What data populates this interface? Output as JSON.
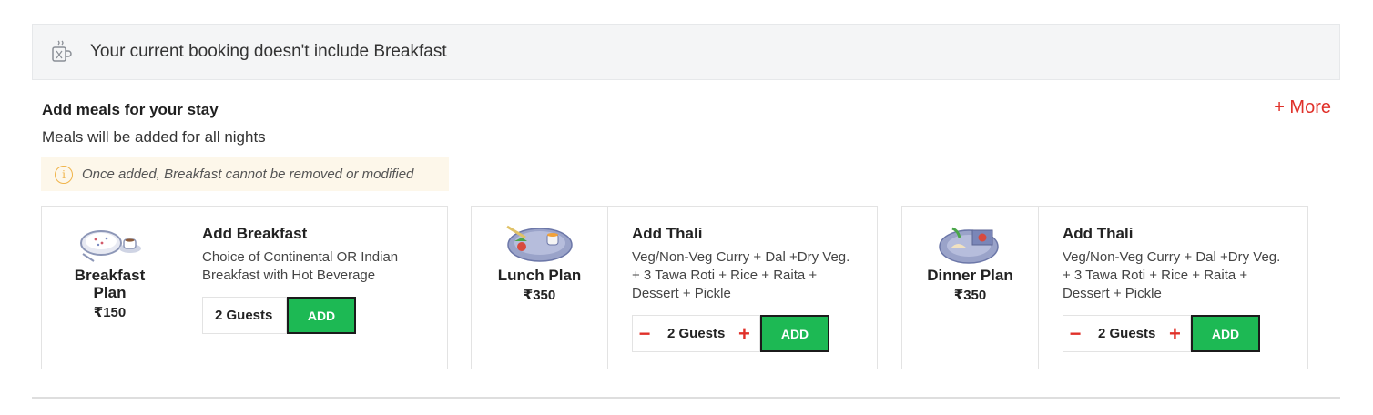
{
  "banner": {
    "text": "Your current booking doesn't include Breakfast",
    "icon": "coffee-cup-icon"
  },
  "section": {
    "title": "Add meals for your stay",
    "subtitle": "Meals will be added for all nights",
    "more_label": "+ More"
  },
  "notice": {
    "text": "Once added, Breakfast cannot be removed or modified",
    "icon": "info-icon"
  },
  "cards": [
    {
      "plan_name": "Breakfast Plan",
      "price": "₹150",
      "title": "Add Breakfast",
      "description": "Choice of Continental OR Indian Breakfast with Hot Beverage",
      "guests": "2 Guests",
      "add_label": "ADD",
      "icon": "breakfast-bowl-icon"
    },
    {
      "plan_name": "Lunch Plan",
      "price": "₹350",
      "title": "Add Thali",
      "description": "Veg/Non-Veg Curry + Dal +Dry Veg. + 3 Tawa Roti + Rice + Raita + Dessert + Pickle",
      "guests": "2 Guests",
      "add_label": "ADD",
      "icon": "lunch-plate-icon"
    },
    {
      "plan_name": "Dinner Plan",
      "price": "₹350",
      "title": "Add Thali",
      "description": "Veg/Non-Veg Curry + Dal +Dry Veg. + 3 Tawa Roti + Rice + Raita + Dessert + Pickle",
      "guests": "2 Guests",
      "add_label": "ADD",
      "icon": "dinner-plate-icon"
    }
  ],
  "colors": {
    "accent_red": "#e0312a",
    "add_green": "#1db954",
    "notice_bg": "#fdf7ea"
  }
}
